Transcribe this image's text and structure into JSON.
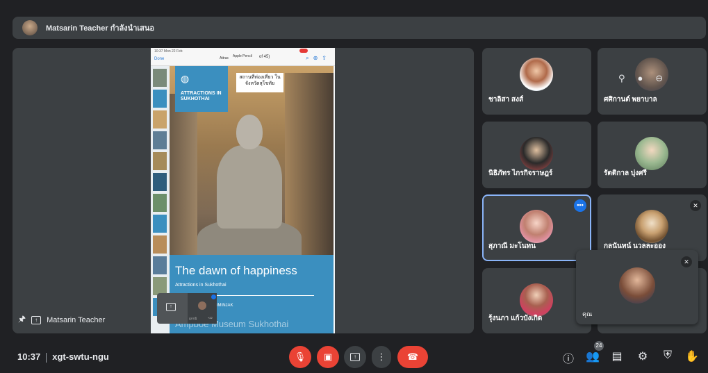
{
  "banner": {
    "text": "Matsarin Teacher กำลังนำเสนอ"
  },
  "presentation": {
    "presenter_name": "Matsarin Teacher",
    "ipad": {
      "time": "10:37 Mon 22 Feb",
      "done": "Done",
      "attr": "Attrac",
      "pencil": "Apple Pencil",
      "page": "of 45)"
    },
    "slide": {
      "badge_title": "ATTRACTIONS IN SUKHOTHAI",
      "thai_box": "สถานที่ท่องเที่ยว ในจังหวัดสุโขทัย",
      "heading": "The dawn of happiness",
      "subheading": "Attractions in Sukhothai",
      "author": "MISS MATSARIN CHUMINJAK",
      "faded_next": "Ampboe Museum Sukhothai"
    },
    "mini_tile": {
      "label": "สุภาณี",
      "count": "+22"
    }
  },
  "participants": [
    {
      "name": "ชาลิสา สงส์",
      "mic_off": false
    },
    {
      "name": "ศศิกานต์ พยาบาล",
      "mic_off": false
    },
    {
      "name": "นิธิภัทร ไกรกิจราษฎร์",
      "mic_off": false
    },
    {
      "name": "รัตติกาล บุ่งศรี",
      "mic_off": false
    },
    {
      "name": "สุภาณี มะโนทน",
      "mic_off": false
    },
    {
      "name": "กลนันทน์ นวลละออง",
      "mic_off": true
    },
    {
      "name": "รุ้งนภา แก้วบังเกิด",
      "mic_off": false
    }
  ],
  "self_view": {
    "name": "คุณ"
  },
  "bottom_bar": {
    "time": "10:37",
    "meeting_code": "xgt-swtu-ngu",
    "participant_count": "24"
  },
  "colors": {
    "background": "#202124",
    "tile": "#3c4043",
    "danger": "#ea4335",
    "accent": "#1a73e8"
  },
  "icons": [
    "pin-icon",
    "present-icon",
    "mic-off-icon",
    "camera-off-icon",
    "more-vert-icon",
    "hang-up-icon",
    "info-icon",
    "people-icon",
    "chat-icon",
    "activities-icon",
    "host-controls-icon",
    "hand-raise-icon"
  ]
}
